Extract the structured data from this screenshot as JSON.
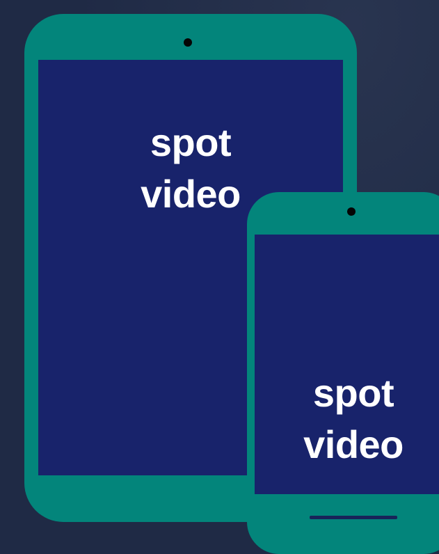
{
  "tablet": {
    "label_line1": "spot",
    "label_line2": "video"
  },
  "phone": {
    "label_line1": "spot",
    "label_line2": "video"
  },
  "colors": {
    "background": "#1f2a45",
    "device_body": "#03857b",
    "screen": "#18236b",
    "text": "#ffffff",
    "camera": "#050505"
  }
}
